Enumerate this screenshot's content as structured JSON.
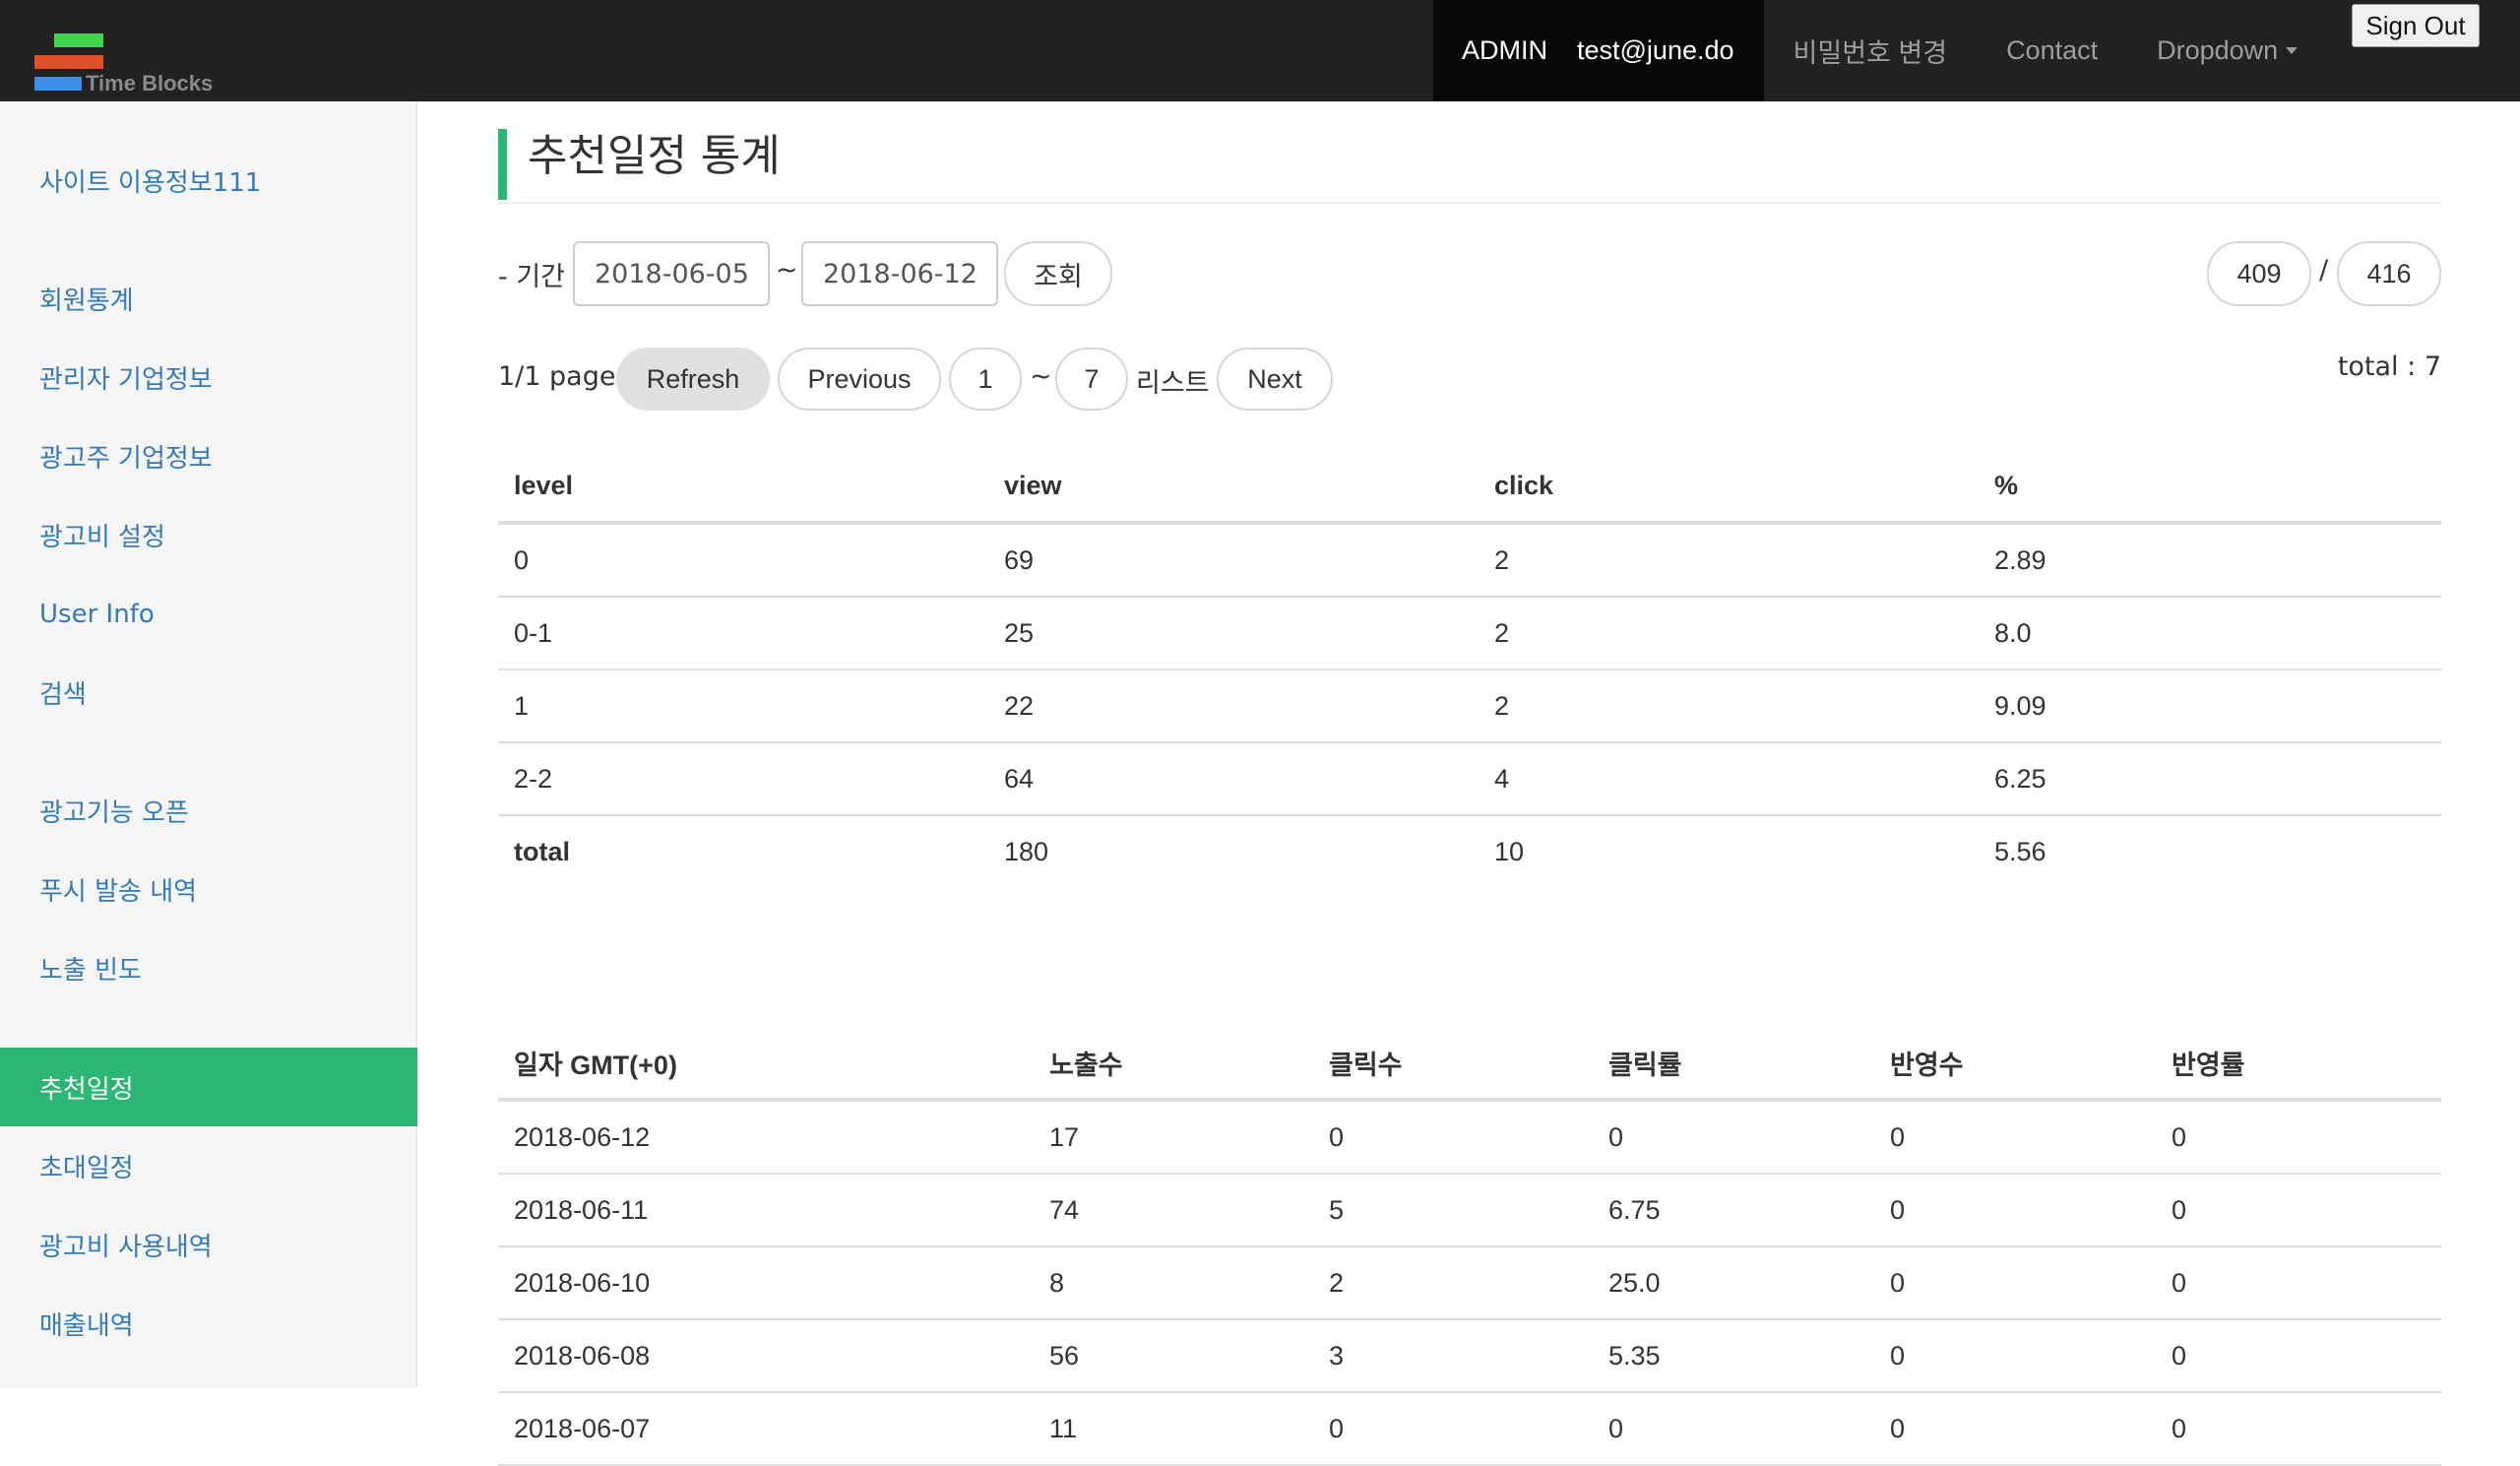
{
  "brand": {
    "logo_text": "Time Blocks"
  },
  "navbar": {
    "admin": "ADMIN",
    "email": "test@june.do",
    "change_password": "비밀번호 변경",
    "contact": "Contact",
    "dropdown": "Dropdown",
    "sign_out": "Sign Out"
  },
  "sidebar": {
    "items": [
      {
        "label": "사이트 이용정보111"
      },
      {
        "label": "회원통계"
      },
      {
        "label": "관리자 기업정보"
      },
      {
        "label": "광고주 기업정보"
      },
      {
        "label": "광고비 설정"
      },
      {
        "label": "User Info"
      },
      {
        "label": "검색"
      },
      {
        "label": "광고기능 오픈"
      },
      {
        "label": "푸시 발송 내역"
      },
      {
        "label": "노출 빈도"
      },
      {
        "label": "추천일정"
      },
      {
        "label": "초대일정"
      },
      {
        "label": "광고비 사용내역"
      },
      {
        "label": "매출내역"
      }
    ],
    "active_index": 10
  },
  "main": {
    "title": "추천일정 통계",
    "period_label": "- 기간",
    "date_from": "2018-06-05",
    "date_sep": "~",
    "date_to": "2018-06-12",
    "search_button": "조회",
    "counter_left": "409",
    "counter_sep": "/",
    "counter_right": "416",
    "page_info": "1/1 page",
    "refresh": "Refresh",
    "previous": "Previous",
    "range_start": "1",
    "range_sep": "~",
    "range_end": "7",
    "list_label": "리스트",
    "next": "Next",
    "total_label": "total : 7"
  },
  "level_table": {
    "headers": [
      "level",
      "view",
      "click",
      "%"
    ],
    "rows": [
      [
        "0",
        "69",
        "2",
        "2.89"
      ],
      [
        "0-1",
        "25",
        "2",
        "8.0"
      ],
      [
        "1",
        "22",
        "2",
        "9.09"
      ],
      [
        "2-2",
        "64",
        "4",
        "6.25"
      ],
      [
        "total",
        "180",
        "10",
        "5.56"
      ]
    ]
  },
  "daily_table": {
    "headers": [
      "일자 GMT(+0)",
      "노출수",
      "클릭수",
      "클릭률",
      "반영수",
      "반영률"
    ],
    "rows": [
      [
        "2018-06-12",
        "17",
        "0",
        "0",
        "0",
        "0"
      ],
      [
        "2018-06-11",
        "74",
        "5",
        "6.75",
        "0",
        "0"
      ],
      [
        "2018-06-10",
        "8",
        "2",
        "25.0",
        "0",
        "0"
      ],
      [
        "2018-06-08",
        "56",
        "3",
        "5.35",
        "0",
        "0"
      ],
      [
        "2018-06-07",
        "11",
        "0",
        "0",
        "0",
        "0"
      ]
    ]
  }
}
